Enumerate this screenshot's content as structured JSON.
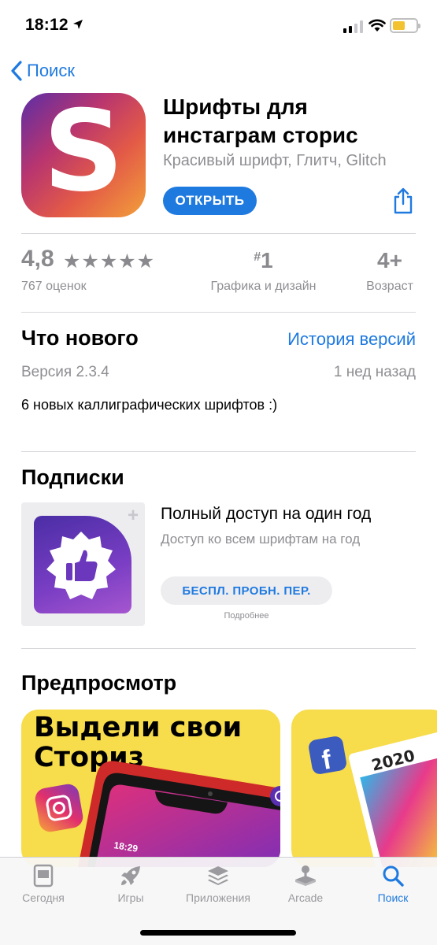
{
  "status_bar": {
    "time": "18:12"
  },
  "nav": {
    "back_label": "Поиск"
  },
  "app": {
    "title": "Шрифты для инстаграм сторис",
    "subtitle": "Красивый шрифт, Глитч, Glitch",
    "icon_letter": "S",
    "open_button": "ОТКРЫТЬ"
  },
  "stats": {
    "rating": "4,8",
    "stars": "★★★★★",
    "stars_value": 4.8,
    "rating_count": "767 оценок",
    "rank": "1",
    "rank_prefix": "#",
    "rank_category": "Графика и дизайн",
    "age": "4+",
    "age_label": "Возраст"
  },
  "whats_new": {
    "title": "Что нового",
    "history_link": "История версий",
    "version": "Версия 2.3.4",
    "date": "1 нед назад",
    "notes": "6 новых каллиграфических шрифтов :)"
  },
  "subscriptions": {
    "title": "Подписки",
    "plus": "+",
    "name": "Полный доступ на один год",
    "description": "Доступ ко всем шрифтам на год",
    "button": "БЕСПЛ. ПРОБН. ПЕР.",
    "more": "Подробнее"
  },
  "preview": {
    "title": "Предпросмотр",
    "shot1_text": "Выдели свои Сториз",
    "shot1_time": "18:29",
    "shot2_year": "2020"
  },
  "tabbar": {
    "tabs": [
      {
        "label": "Сегодня",
        "icon": "today-icon",
        "active": false
      },
      {
        "label": "Игры",
        "icon": "rocket-icon",
        "active": false
      },
      {
        "label": "Приложения",
        "icon": "apps-stack-icon",
        "active": false
      },
      {
        "label": "Arcade",
        "icon": "arcade-joystick-icon",
        "active": false
      },
      {
        "label": "Поиск",
        "icon": "search-icon",
        "active": true
      }
    ]
  },
  "colors": {
    "accent": "#1f7ae0",
    "secondary_text": "#8e8e93",
    "preview_yellow": "#f7dc4b"
  }
}
